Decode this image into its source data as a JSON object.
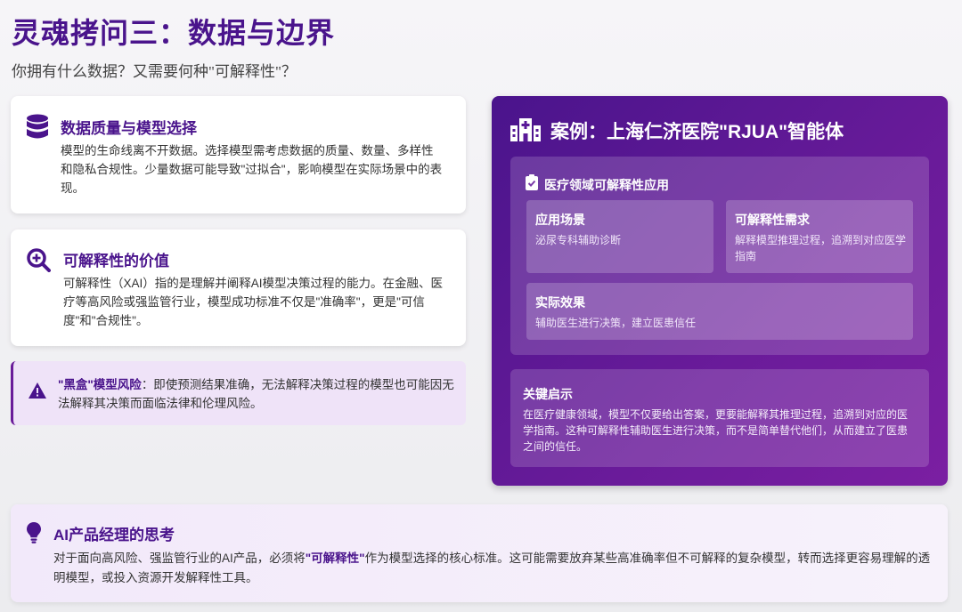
{
  "header": {
    "title": "灵魂拷问三：数据与边界",
    "subtitle": "你拥有什么数据？又需要何种\"可解释性\"？"
  },
  "left": {
    "card1": {
      "icon": "database-icon",
      "title": "数据质量与模型选择",
      "text": "模型的生命线离不开数据。选择模型需考虑数据的质量、数量、多样性和隐私合规性。少量数据可能导致\"过拟合\"，影响模型在实际场景中的表现。"
    },
    "card2": {
      "icon": "search-plus-icon",
      "title": "可解释性的价值",
      "text": "可解释性（XAI）指的是理解并阐释AI模型决策过程的能力。在金融、医疗等高风险或强监管行业，模型成功标准不仅是\"准确率\"，更是\"可信度\"和\"合规性\"。"
    },
    "warning": {
      "icon": "warning-icon",
      "label": "\"黑盒\"模型风险",
      "text": "：即使预测结果准确，无法解释决策过程的模型也可能因无法解释其决策而面临法律和伦理风险。"
    }
  },
  "case": {
    "icon": "hospital-icon",
    "title": "案例：上海仁济医院\"RJUA\"智能体",
    "application": {
      "icon": "clipboard-check-icon",
      "title": "医疗领域可解释性应用",
      "cells": [
        {
          "title": "应用场景",
          "text": "泌尿专科辅助诊断"
        },
        {
          "title": "可解释性需求",
          "text": "解释模型推理过程，追溯到对应医学指南"
        },
        {
          "title": "实际效果",
          "text": "辅助医生进行决策，建立医患信任"
        }
      ]
    },
    "insight": {
      "title": "关键启示",
      "text": "在医疗健康领域，模型不仅要给出答案，更要能解释其推理过程，追溯到对应的医学指南。这种可解释性辅助医生进行决策，而不是简单替代他们，从而建立了医患之间的信任。"
    }
  },
  "bottom": {
    "icon": "lightbulb-icon",
    "title": "AI产品经理的思考",
    "text_before": "对于面向高风险、强监管行业的AI产品，必须将",
    "text_bold": "\"可解释性\"",
    "text_after": "作为模型选择的核心标准。这可能需要放弃某些高准确率但不可解释的复杂模型，转而选择更容易理解的透明模型，或投入资源开发解释性工具。"
  },
  "colors": {
    "brand": "#4a148c",
    "panel_gradient_end": "#7b1fa2"
  }
}
